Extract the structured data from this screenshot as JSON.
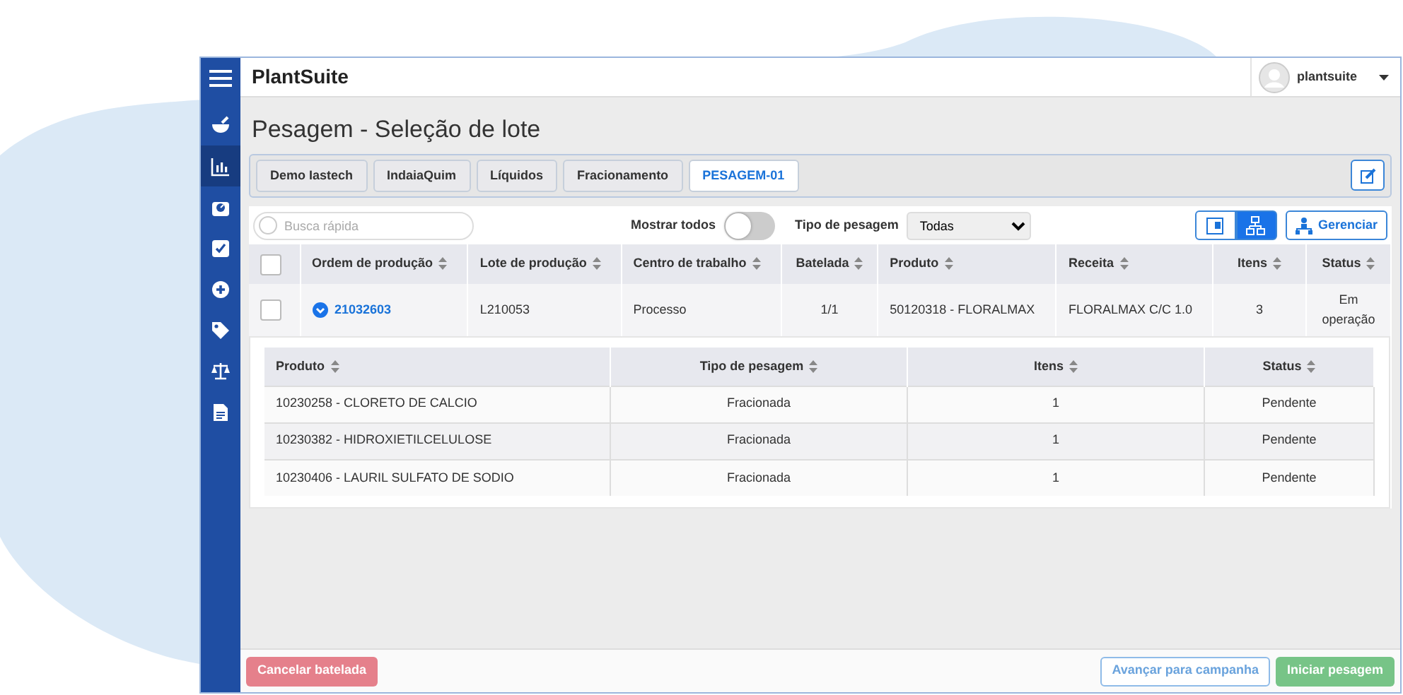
{
  "app_title": "PlantSuite",
  "user": {
    "name": "plantsuite"
  },
  "sidebar": {
    "items": [
      {
        "selected": false
      },
      {
        "selected": true
      },
      {
        "selected": false
      },
      {
        "selected": false
      },
      {
        "selected": false
      },
      {
        "selected": false
      },
      {
        "selected": false
      },
      {
        "selected": false
      }
    ]
  },
  "page_title": "Pesagem - Seleção de lote",
  "breadcrumb": [
    {
      "label": "Demo Iastech",
      "selected": false
    },
    {
      "label": "IndaiaQuim",
      "selected": false
    },
    {
      "label": "Líquidos",
      "selected": false
    },
    {
      "label": "Fracionamento",
      "selected": false
    },
    {
      "label": "PESAGEM-01",
      "selected": true
    }
  ],
  "toolbar": {
    "search": {
      "placeholder": "Busca rápida"
    },
    "show_all": {
      "label": "Mostrar todos",
      "on": false
    },
    "weighing_type": {
      "label": "Tipo de pesagem",
      "value": "Todas"
    },
    "view_buttons": [
      {
        "selected": false
      },
      {
        "selected": true
      }
    ],
    "manage_button": "Gerenciar"
  },
  "table": {
    "select_all": {
      "checked": false
    },
    "columns": [
      "Ordem de produção",
      "Lote de produção",
      "Centro de trabalho",
      "Batelada",
      "Produto",
      "Receita",
      "Itens",
      "Status"
    ],
    "rows": [
      {
        "checked": false,
        "expanded": true,
        "cells": [
          "21032603",
          "L210053",
          "Processo",
          "1/1",
          "50120318 - FLORALMAX",
          "FLORALMAX C/C 1.0",
          "3",
          "Em operação"
        ],
        "detail": {
          "columns": [
            "Produto",
            "Tipo de pesagem",
            "Itens",
            "Status"
          ],
          "rows": [
            [
              "10230258 - CLORETO DE CALCIO",
              "Fracionada",
              "1",
              "Pendente"
            ],
            [
              "10230382 - HIDROXIETILCELULOSE",
              "Fracionada",
              "1",
              "Pendente"
            ],
            [
              "10230406 - LAURIL SULFATO DE SODIO",
              "Fracionada",
              "1",
              "Pendente"
            ]
          ]
        }
      }
    ]
  },
  "footer": {
    "buttons": [
      {
        "label": "Cancelar batelada",
        "kind": "danger"
      },
      {
        "label": "Avançar para campanha",
        "kind": "outline"
      },
      {
        "label": "Iniciar pesagem",
        "kind": "success"
      }
    ]
  }
}
